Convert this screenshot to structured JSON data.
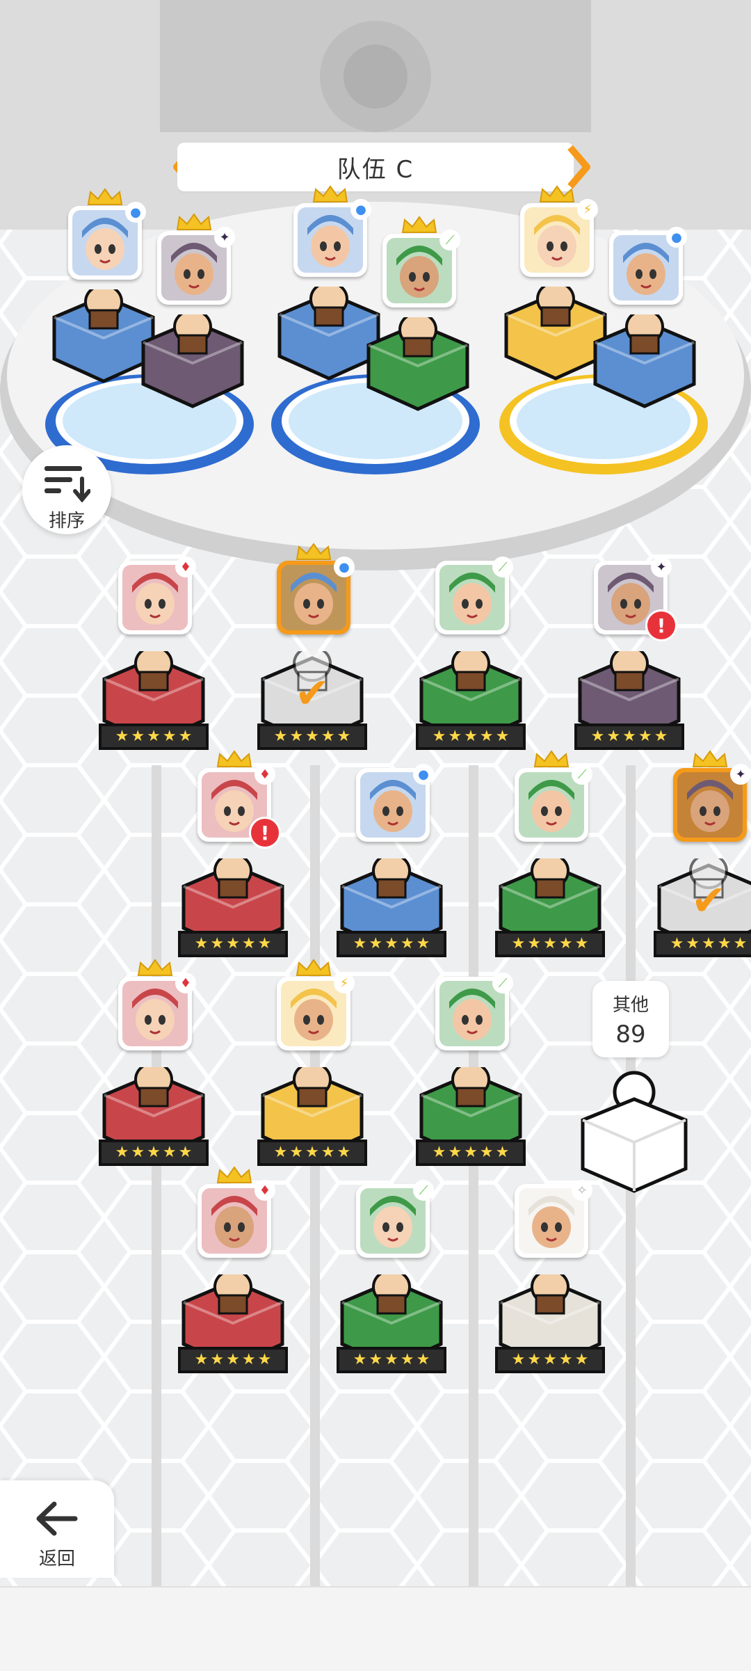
{
  "team": {
    "name": "队伍 C"
  },
  "controls": {
    "sort_label": "排序",
    "back_label": "返回"
  },
  "others": {
    "label": "其他",
    "count": "89"
  },
  "team_slots": [
    {
      "slot": "left-back",
      "element": "blue",
      "crown": true
    },
    {
      "slot": "left-front",
      "element": "purple",
      "crown": true
    },
    {
      "slot": "mid-back",
      "element": "blue",
      "crown": true
    },
    {
      "slot": "mid-front",
      "element": "green",
      "crown": true
    },
    {
      "slot": "right-back",
      "element": "yellow",
      "crown": true
    },
    {
      "slot": "right-front",
      "element": "blue",
      "crown": false
    }
  ],
  "roster": [
    {
      "row": 1,
      "element": "red",
      "stars": 5,
      "crown": false,
      "selected": false,
      "alert": false
    },
    {
      "row": 1,
      "element": "blue",
      "stars": 5,
      "crown": true,
      "selected": true,
      "alert": false
    },
    {
      "row": 1,
      "element": "green",
      "stars": 5,
      "crown": false,
      "selected": false,
      "alert": false
    },
    {
      "row": 1,
      "element": "purple",
      "stars": 5,
      "crown": false,
      "selected": false,
      "alert": true
    },
    {
      "row": 2,
      "element": "red",
      "stars": 5,
      "crown": true,
      "selected": false,
      "alert": true
    },
    {
      "row": 2,
      "element": "blue",
      "stars": 5,
      "crown": false,
      "selected": false,
      "alert": false
    },
    {
      "row": 2,
      "element": "green",
      "stars": 5,
      "crown": true,
      "selected": false,
      "alert": false
    },
    {
      "row": 2,
      "element": "purple",
      "stars": 5,
      "crown": true,
      "selected": true,
      "alert": false
    },
    {
      "row": 3,
      "element": "red",
      "stars": 5,
      "crown": true,
      "selected": false,
      "alert": false
    },
    {
      "row": 3,
      "element": "yellow",
      "stars": 5,
      "crown": true,
      "selected": false,
      "alert": false
    },
    {
      "row": 3,
      "element": "green",
      "stars": 5,
      "crown": false,
      "selected": false,
      "alert": false
    },
    {
      "row": 4,
      "element": "red",
      "stars": 5,
      "crown": true,
      "selected": false,
      "alert": false
    },
    {
      "row": 4,
      "element": "green",
      "stars": 5,
      "crown": false,
      "selected": false,
      "alert": false
    },
    {
      "row": 4,
      "element": "white",
      "stars": 5,
      "crown": false,
      "selected": false,
      "alert": false
    }
  ],
  "colors": {
    "accent": "#f59a1a",
    "red": "#c8464a",
    "blue": "#5b8fd1",
    "green": "#3e9a48",
    "purple": "#6e5a73",
    "yellow": "#f3c34a",
    "white": "#e6e2da"
  }
}
